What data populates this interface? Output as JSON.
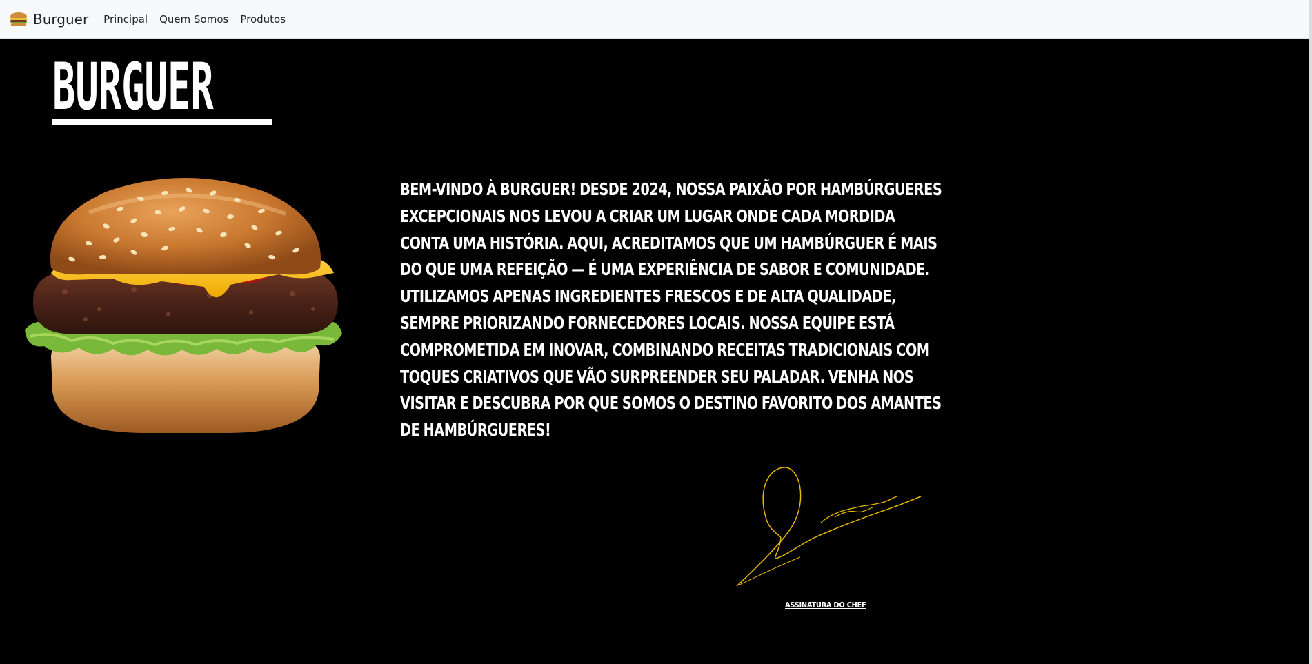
{
  "navbar": {
    "brand_icon": "burger-icon",
    "brand_label": "Burguer",
    "links": [
      {
        "label": "Principal"
      },
      {
        "label": "Quem Somos"
      },
      {
        "label": "Produtos"
      }
    ]
  },
  "hero": {
    "title": "BURGUER",
    "image": "burger-photo",
    "description": "BEM-VINDO À BURGUER! DESDE 2024, NOSSA PAIXÃO POR HAMBÚRGUERES EXCEPCIONAIS NOS LEVOU A CRIAR UM LUGAR ONDE CADA MORDIDA CONTA UMA HISTÓRIA. AQUI, ACREDITAMOS QUE UM HAMBÚRGUER É MAIS DO QUE UMA REFEIÇÃO — É UMA EXPERIÊNCIA DE SABOR E COMUNIDADE. UTILIZAMOS APENAS INGREDIENTES FRESCOS E DE ALTA QUALIDADE, SEMPRE PRIORIZANDO FORNECEDORES LOCAIS. NOSSA EQUIPE ESTÁ COMPROMETIDA EM INOVAR, COMBINANDO RECEITAS TRADICIONAIS COM TOQUES CRIATIVOS QUE VÃO SURPREENDER SEU PALADAR. VENHA NOS VISITAR E DESCUBRA POR QUE SOMOS O DESTINO FAVORITO DOS AMANTES DE HAMBÚRGUERES!",
    "signature_caption": "ASSINATURA DO CHEF"
  },
  "colors": {
    "background": "#000000",
    "navbar_background": "#f8f9fa",
    "text": "#ffffff",
    "signature_ink": "#e6b800"
  }
}
